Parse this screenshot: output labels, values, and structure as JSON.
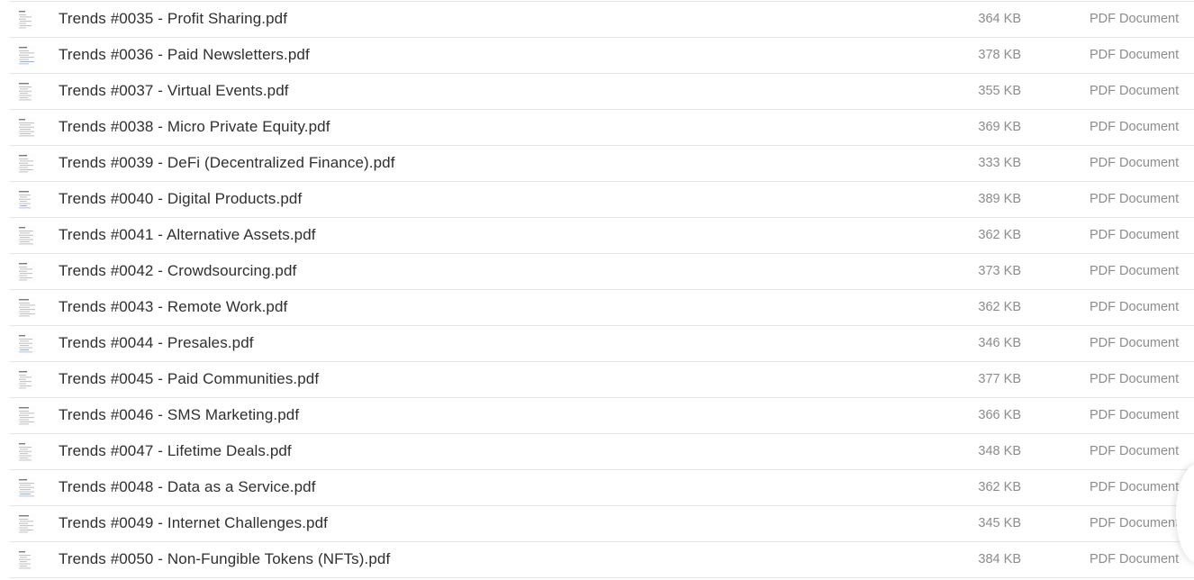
{
  "files": [
    {
      "name": "Trends #0035 - Profit Sharing.pdf",
      "size": "364 KB",
      "type": "PDF Document"
    },
    {
      "name": "Trends #0036 - Paid Newsletters.pdf",
      "size": "378 KB",
      "type": "PDF Document"
    },
    {
      "name": "Trends #0037 - Virtual Events.pdf",
      "size": "355 KB",
      "type": "PDF Document"
    },
    {
      "name": "Trends #0038 - Micro Private Equity.pdf",
      "size": "369 KB",
      "type": "PDF Document"
    },
    {
      "name": "Trends #0039 - DeFi (Decentralized Finance).pdf",
      "size": "333 KB",
      "type": "PDF Document"
    },
    {
      "name": "Trends #0040 - Digital Products.pdf",
      "size": "389 KB",
      "type": "PDF Document"
    },
    {
      "name": "Trends #0041 - Alternative Assets.pdf",
      "size": "362 KB",
      "type": "PDF Document"
    },
    {
      "name": "Trends #0042 - Crowdsourcing.pdf",
      "size": "373 KB",
      "type": "PDF Document"
    },
    {
      "name": "Trends #0043 - Remote Work.pdf",
      "size": "362 KB",
      "type": "PDF Document"
    },
    {
      "name": "Trends #0044 - Presales.pdf",
      "size": "346 KB",
      "type": "PDF Document"
    },
    {
      "name": "Trends #0045 - Paid Communities.pdf",
      "size": "377 KB",
      "type": "PDF Document"
    },
    {
      "name": "Trends #0046 - SMS Marketing.pdf",
      "size": "366 KB",
      "type": "PDF Document"
    },
    {
      "name": "Trends #0047 - Lifetime Deals.pdf",
      "size": "348 KB",
      "type": "PDF Document"
    },
    {
      "name": "Trends #0048 - Data as a Service.pdf",
      "size": "362 KB",
      "type": "PDF Document"
    },
    {
      "name": "Trends #0049 - Internet Challenges.pdf",
      "size": "345 KB",
      "type": "PDF Document"
    },
    {
      "name": "Trends #0050 - Non-Fungible Tokens (NFTs).pdf",
      "size": "384 KB",
      "type": "PDF Document"
    }
  ],
  "icons": {
    "thumbnail": "pdf-thumbnail-icon"
  },
  "colors": {
    "name_text": "#2f2f2f",
    "meta_text": "#8c8c8c",
    "divider": "#e6e6e6"
  }
}
